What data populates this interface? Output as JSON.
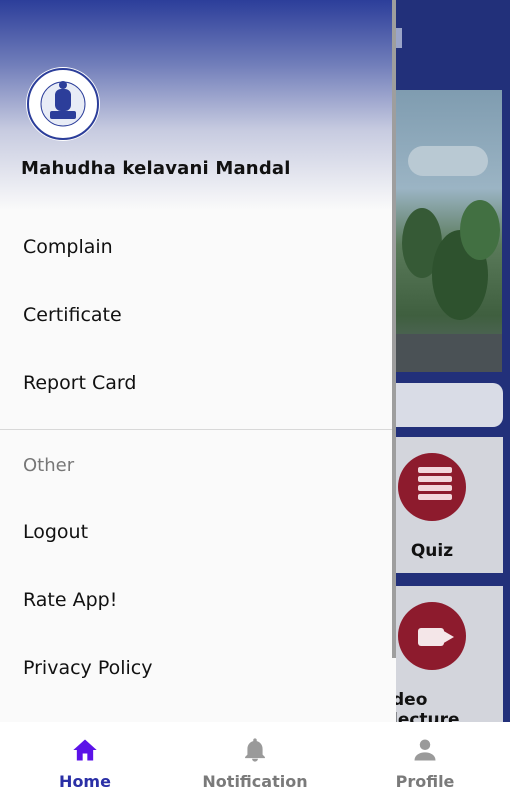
{
  "drawer": {
    "org_name": "Mahudha kelavani Mandal",
    "logo_text": "MAHUDHA KELAVANI MANDAL",
    "items": [
      {
        "label": "Complain"
      },
      {
        "label": "Certificate"
      },
      {
        "label": "Report Card"
      }
    ],
    "other_section": {
      "title": "Other",
      "items": [
        {
          "label": "Logout"
        },
        {
          "label": "Rate App!"
        },
        {
          "label": "Privacy Policy"
        }
      ]
    }
  },
  "background": {
    "cards": [
      {
        "label": "Quiz"
      },
      {
        "label": "deo lecture"
      }
    ]
  },
  "bottom_nav": {
    "active": "Home",
    "items": [
      {
        "label": "Home",
        "icon": "home-icon"
      },
      {
        "label": "Notification",
        "icon": "bell-icon"
      },
      {
        "label": "Profile",
        "icon": "person-icon"
      }
    ]
  },
  "colors": {
    "primary": "#2c3e9a",
    "active_nav": "#2a2fa6",
    "active_icon": "#5b12e8",
    "inactive_nav": "#7a7a7a",
    "card_accent": "#8d1b2d"
  }
}
